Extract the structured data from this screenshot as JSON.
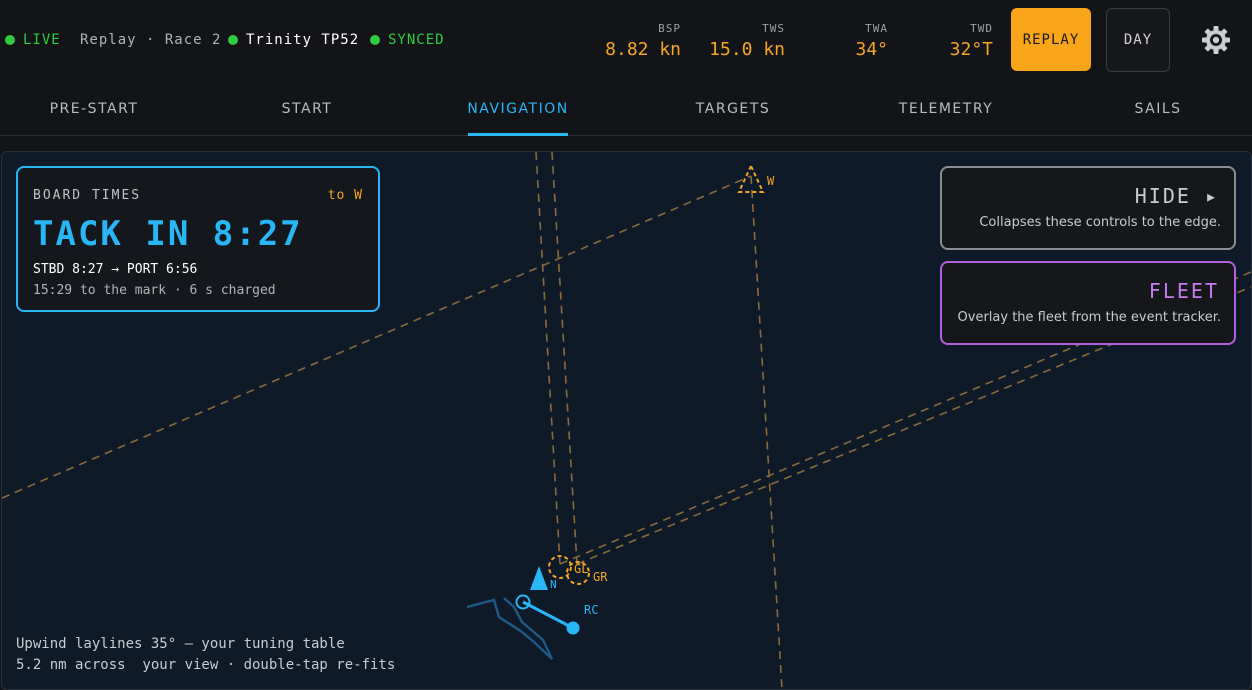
{
  "status": {
    "live_label": "LIVE",
    "session": "Replay · Race 2",
    "boat": "Trinity TP52",
    "sync": "SYNCED"
  },
  "metrics": [
    {
      "label": "BSP",
      "value": "8.82 kn"
    },
    {
      "label": "TWS",
      "value": "15.0 kn"
    },
    {
      "label": "TWA",
      "value": "34°"
    },
    {
      "label": "TWD",
      "value": "32°T"
    }
  ],
  "buttons": {
    "replay": "REPLAY",
    "day": "DAY",
    "settings_icon": "gear-icon"
  },
  "tabs": [
    {
      "label": "PRE-START",
      "active": false
    },
    {
      "label": "START",
      "active": false
    },
    {
      "label": "NAVIGATION",
      "active": true
    },
    {
      "label": "TARGETS",
      "active": false
    },
    {
      "label": "TELEMETRY",
      "active": false
    },
    {
      "label": "SAILS",
      "active": false
    }
  ],
  "board_times": {
    "title": "BOARD TIMES",
    "destination": "to W",
    "headline": "TACK IN 8:27",
    "boards": "STBD 8:27 → PORT 6:56",
    "detail": "15:29 to the mark · 6 s charged"
  },
  "hide_card": {
    "title": "HIDE ▸",
    "description": "Collapses these controls to the edge."
  },
  "fleet_card": {
    "title": "FLEET",
    "description": "Overlay the fleet from the event tracker."
  },
  "map": {
    "marks": {
      "windward": "W",
      "gate_left": "GL",
      "gate_right": "GR",
      "committee": "RC",
      "north": "N"
    }
  },
  "footer": {
    "line1": "Upwind laylines 35° — your tuning table",
    "line2": "5.2 nm across  your view · double-tap re-fits"
  },
  "colors": {
    "accent": "#29b6f6",
    "warning": "#f9a51a",
    "mark": "#f5a623",
    "fleet": "#b65ee0",
    "ok": "#2ecc40",
    "background": "#121417",
    "map": "#0e1a28"
  }
}
